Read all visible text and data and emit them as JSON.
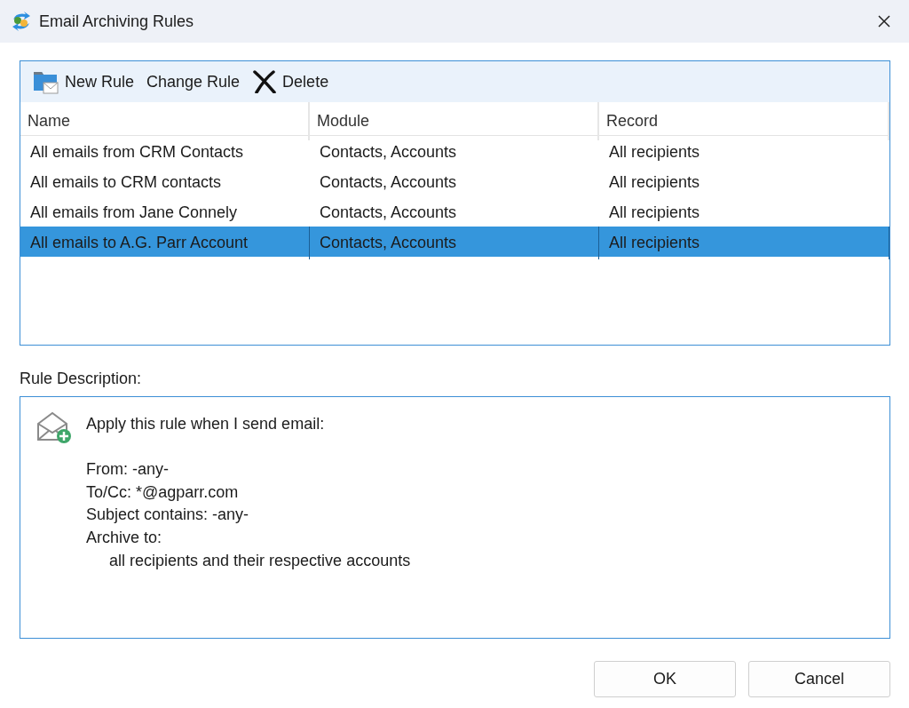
{
  "window": {
    "title": "Email Archiving Rules"
  },
  "toolbar": [
    {
      "label": "New Rule",
      "kind": "new"
    },
    {
      "label": "Change Rule",
      "kind": "plain"
    },
    {
      "label": "Delete",
      "kind": "delete"
    }
  ],
  "table": {
    "columns": [
      "Name",
      "Module",
      "Record"
    ],
    "rows": [
      {
        "cells": [
          "All emails from CRM Contacts",
          "Contacts, Accounts",
          "All recipients"
        ],
        "selected": false
      },
      {
        "cells": [
          "All emails to CRM contacts",
          "Contacts, Accounts",
          "All recipients"
        ],
        "selected": false
      },
      {
        "cells": [
          "All emails from Jane Connely",
          "Contacts, Accounts",
          "All recipients"
        ],
        "selected": false
      },
      {
        "cells": [
          "All emails to A.G. Parr Account",
          "Contacts, Accounts",
          "All recipients"
        ],
        "selected": true
      }
    ]
  },
  "description": {
    "label": "Rule Description:",
    "heading": "Apply this rule when I send email:",
    "lines": [
      {
        "text": "From: -any-"
      },
      {
        "text": "To/Cc: *@agparr.com"
      },
      {
        "text": "Subject contains: -any-"
      },
      {
        "text": "Archive to:",
        "children": [
          {
            "text": "all recipients and their respective accounts"
          }
        ]
      }
    ]
  },
  "buttons": [
    "OK",
    "Cancel"
  ]
}
